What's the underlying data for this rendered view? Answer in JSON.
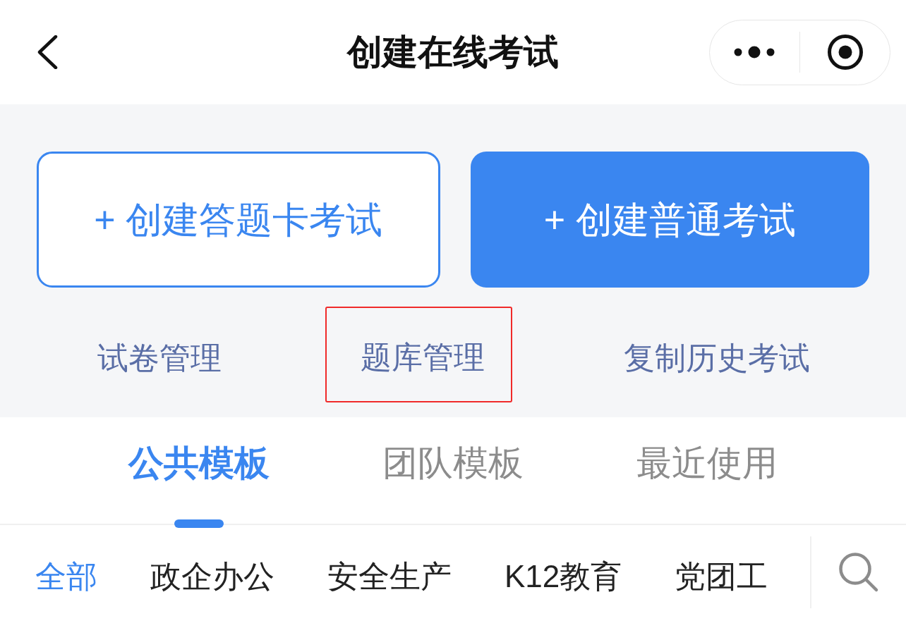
{
  "nav_bar": {
    "title": "创建在线考试"
  },
  "create_buttons": [
    {
      "label": "+ 创建答题卡考试",
      "kind": "outline"
    },
    {
      "label": "+ 创建普通考试",
      "kind": "filled"
    }
  ],
  "quick_links": [
    {
      "label": "试卷管理",
      "highlighted": false
    },
    {
      "label": "题库管理",
      "highlighted": true
    },
    {
      "label": "复制历史考试",
      "highlighted": false
    }
  ],
  "template_tabs": [
    {
      "label": "公共模板",
      "selected": true
    },
    {
      "label": "团队模板",
      "selected": false
    },
    {
      "label": "最近使用",
      "selected": false
    }
  ],
  "categories": [
    {
      "label": "全部",
      "selected": true
    },
    {
      "label": "政企办公",
      "selected": false
    },
    {
      "label": "安全生产",
      "selected": false
    },
    {
      "label": "K12教育",
      "selected": false
    },
    {
      "label": "党团工",
      "selected": false
    }
  ]
}
